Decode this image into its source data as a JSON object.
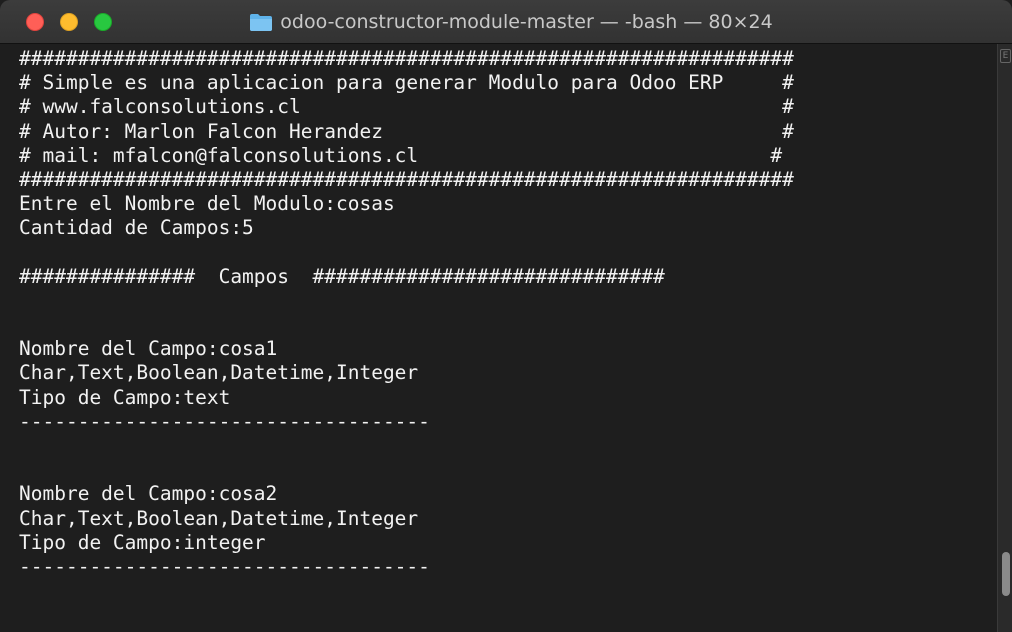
{
  "window": {
    "title": "odoo-constructor-module-master — -bash — 80×24"
  },
  "icons": {
    "folder": "folder-icon",
    "close": "close-icon",
    "minimize": "minimize-icon",
    "zoom": "zoom-icon"
  },
  "colors": {
    "terminal_bg": "#1e1e1e",
    "terminal_fg": "#f2f2f2",
    "folder": "#5fb3ea"
  },
  "terminal": {
    "lines": [
      "##################################################################",
      "# Simple es una aplicacion para generar Modulo para Odoo ERP     #",
      "# www.falconsolutions.cl                                         #",
      "# Autor: Marlon Falcon Herandez                                  #",
      "# mail: mfalcon@falconsolutions.cl                              #",
      "##################################################################",
      "Entre el Nombre del Modulo:cosas",
      "Cantidad de Campos:5",
      "",
      "###############  Campos  ##############################",
      "",
      "",
      "Nombre del Campo:cosa1",
      "Char,Text,Boolean,Datetime,Integer",
      "Tipo de Campo:text",
      "-----------------------------------",
      "",
      "",
      "Nombre del Campo:cosa2",
      "Char,Text,Boolean,Datetime,Integer",
      "Tipo de Campo:integer",
      "-----------------------------------",
      "",
      ""
    ]
  },
  "scrollbar": {
    "marker": "E"
  }
}
